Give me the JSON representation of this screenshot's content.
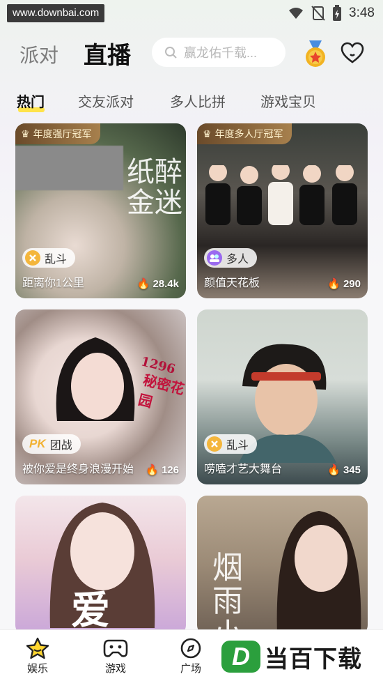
{
  "status": {
    "url_watermark": "www.downbai.com",
    "time": "3:48"
  },
  "header": {
    "tabs": [
      "派对",
      "直播"
    ],
    "active_tab": "直播",
    "search_placeholder": "赢龙佑千载..."
  },
  "subtabs": [
    "热门",
    "交友派对",
    "多人比拼",
    "游戏宝贝"
  ],
  "cards": [
    {
      "badge": "年度强厅冠军",
      "tag": "乱斗",
      "title": "距离你1公里",
      "hot": "28.4k",
      "overlay": "纸醉金迷"
    },
    {
      "badge": "年度多人厅冠军",
      "tag": "多人",
      "title": "颜值天花板",
      "hot": "290"
    },
    {
      "tag": "团战",
      "tag_prefix": "PK",
      "title": "被你爱是终身浪漫开始",
      "hot": "126",
      "overlay": "秘密花园",
      "overlay_num": "1296"
    },
    {
      "tag": "乱斗",
      "title": "唠嗑才艺大舞台",
      "hot": "345"
    },
    {
      "overlay": "爱"
    },
    {
      "overlay": "烟雨小"
    }
  ],
  "bottom_nav": [
    "娱乐",
    "游戏",
    "广场"
  ],
  "brand": {
    "logo_letter": "D",
    "text": "当百下载"
  },
  "colors": {
    "accent_yellow": "#ffe34a",
    "badge_gold": "#a7804d",
    "brand_green": "#2b9f3d"
  }
}
